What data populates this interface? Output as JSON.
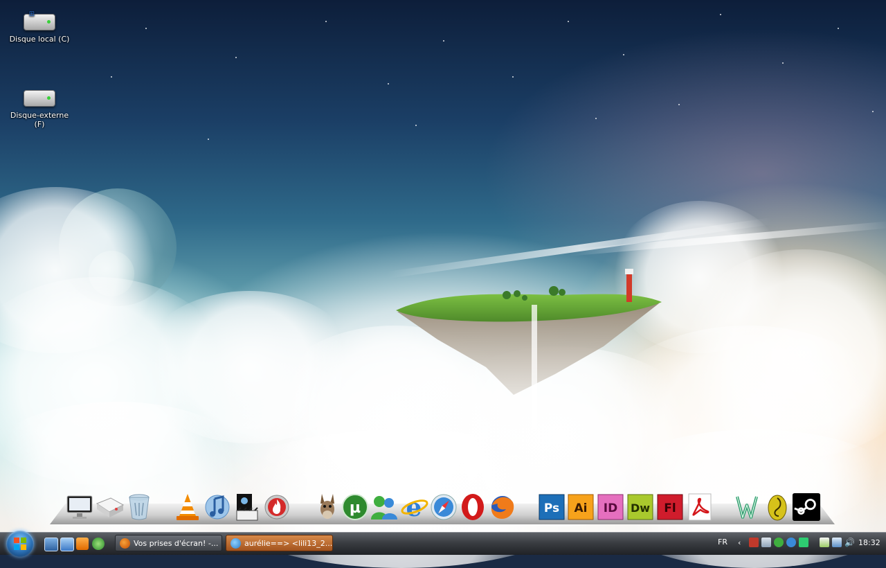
{
  "desktop": {
    "icons": [
      {
        "label": "Disque local (C)"
      },
      {
        "label": "Disque-externe (F)"
      }
    ]
  },
  "dock": {
    "items": [
      {
        "name": "computer",
        "icon": "monitor-icon"
      },
      {
        "name": "network-drive",
        "icon": "drive-icon"
      },
      {
        "name": "recycle-bin",
        "icon": "trash-icon"
      },
      {
        "name": "vlc",
        "icon": "traffic-cone-icon"
      },
      {
        "name": "itunes",
        "icon": "music-note-icon"
      },
      {
        "name": "movie-maker",
        "icon": "clapperboard-icon"
      },
      {
        "name": "nero",
        "icon": "flame-icon"
      },
      {
        "name": "emule",
        "icon": "donkey-icon"
      },
      {
        "name": "utorrent",
        "icon": "mu-icon"
      },
      {
        "name": "msn-messenger",
        "icon": "buddies-icon"
      },
      {
        "name": "internet-explorer",
        "icon": "ie-icon"
      },
      {
        "name": "safari",
        "icon": "compass-icon"
      },
      {
        "name": "opera",
        "icon": "opera-o-icon"
      },
      {
        "name": "firefox",
        "icon": "firefox-icon"
      },
      {
        "name": "photoshop",
        "icon": "ps-icon",
        "text": "Ps"
      },
      {
        "name": "illustrator",
        "icon": "ai-icon",
        "text": "Ai"
      },
      {
        "name": "indesign",
        "icon": "id-icon",
        "text": "ID"
      },
      {
        "name": "dreamweaver",
        "icon": "dw-icon",
        "text": "Dw"
      },
      {
        "name": "flash",
        "icon": "fl-icon",
        "text": "Fl"
      },
      {
        "name": "acrobat",
        "icon": "acrobat-icon"
      },
      {
        "name": "wordpad",
        "icon": "w-icon"
      },
      {
        "name": "alien",
        "icon": "egg-icon"
      },
      {
        "name": "steam",
        "icon": "steam-icon"
      }
    ]
  },
  "taskbar": {
    "tasks": [
      {
        "label": "Vos prises d'écran! -...",
        "icon": "firefox-icon"
      },
      {
        "label": "aurélie==> <lili13_2...",
        "icon": "msn-icon"
      }
    ],
    "language": "FR",
    "clock": "18:32"
  },
  "colors": {
    "taskbar_top": "#5d6167",
    "active_task": "#b8682c",
    "task": "#4a4e55"
  }
}
